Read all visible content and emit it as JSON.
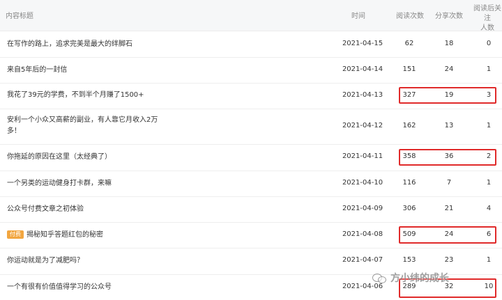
{
  "columns": {
    "title": "内容标题",
    "time": "时间",
    "reads": "阅读次数",
    "shares": "分享次数",
    "follows_line1": "阅读后关注",
    "follows_line2": "人数"
  },
  "rows": [
    {
      "title": "在写作的路上，追求完美是最大的绊脚石",
      "time": "2021-04-15",
      "reads": "62",
      "shares": "18",
      "follows": "0"
    },
    {
      "title": "来自5年后的一封信",
      "time": "2021-04-14",
      "reads": "151",
      "shares": "24",
      "follows": "1"
    },
    {
      "title": "我花了39元的学费，不到半个月赚了1500+",
      "time": "2021-04-13",
      "reads": "327",
      "shares": "19",
      "follows": "3"
    },
    {
      "title": "安利一个小众又高薪的副业，有人靠它月收入2万多！",
      "time": "2021-04-12",
      "reads": "162",
      "shares": "13",
      "follows": "1"
    },
    {
      "title": "你拖延的原因在这里（太经典了）",
      "time": "2021-04-11",
      "reads": "358",
      "shares": "36",
      "follows": "2"
    },
    {
      "title": "一个另类的运动健身打卡群，来嘛",
      "time": "2021-04-10",
      "reads": "116",
      "shares": "7",
      "follows": "1"
    },
    {
      "title": "公众号付费文章之初体验",
      "time": "2021-04-09",
      "reads": "306",
      "shares": "21",
      "follows": "4"
    },
    {
      "badge": "付费",
      "title": "揭秘知乎答题红包的秘密",
      "time": "2021-04-08",
      "reads": "509",
      "shares": "24",
      "follows": "6"
    },
    {
      "title": "你运动就是为了减肥吗？",
      "time": "2021-04-07",
      "reads": "153",
      "shares": "23",
      "follows": "1"
    },
    {
      "title": "一个有很有价值值得学习的公众号",
      "time": "2021-04-06",
      "reads": "289",
      "shares": "32",
      "follows": "10"
    }
  ],
  "watermark": {
    "text": "方小纬的成长",
    "icon": "wechat-icon"
  },
  "colors": {
    "highlight": "#e02a2a",
    "badge": "#f2a640",
    "header_bg": "#f6f7f8"
  }
}
